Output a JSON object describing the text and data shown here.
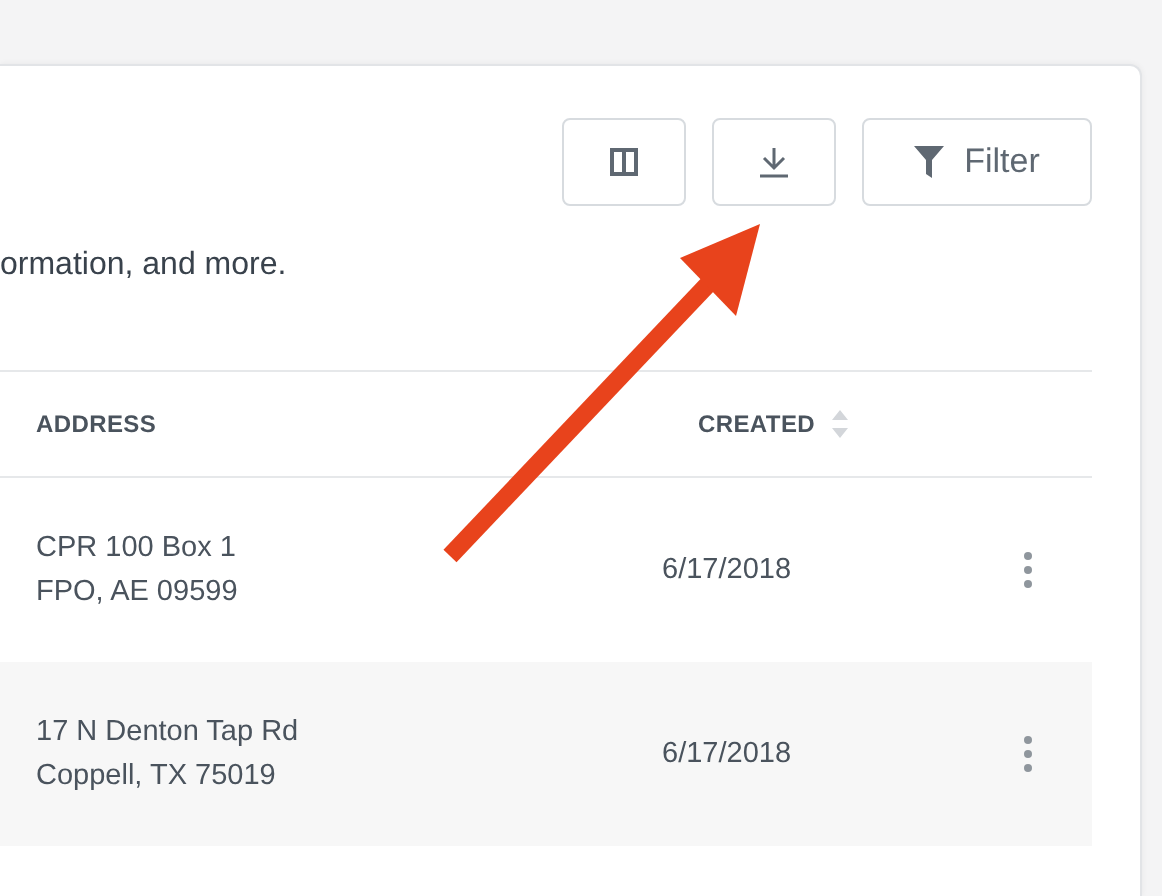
{
  "toolbar": {
    "buttons": [
      {
        "kind": "columns"
      },
      {
        "kind": "download"
      },
      {
        "kind": "filter",
        "label": "Filter"
      }
    ]
  },
  "description": "ormation, and more.",
  "table": {
    "columns": [
      {
        "label": "ADDRESS",
        "sortable": false
      },
      {
        "label": "CREATED",
        "sortable": true
      }
    ],
    "rows": [
      {
        "address": [
          "CPR 100 Box 1",
          "FPO, AE 09599"
        ],
        "created": "6/17/2018"
      },
      {
        "address": [
          "17 N Denton Tap Rd",
          "Coppell, TX 75019"
        ],
        "created": "6/17/2018"
      }
    ]
  }
}
